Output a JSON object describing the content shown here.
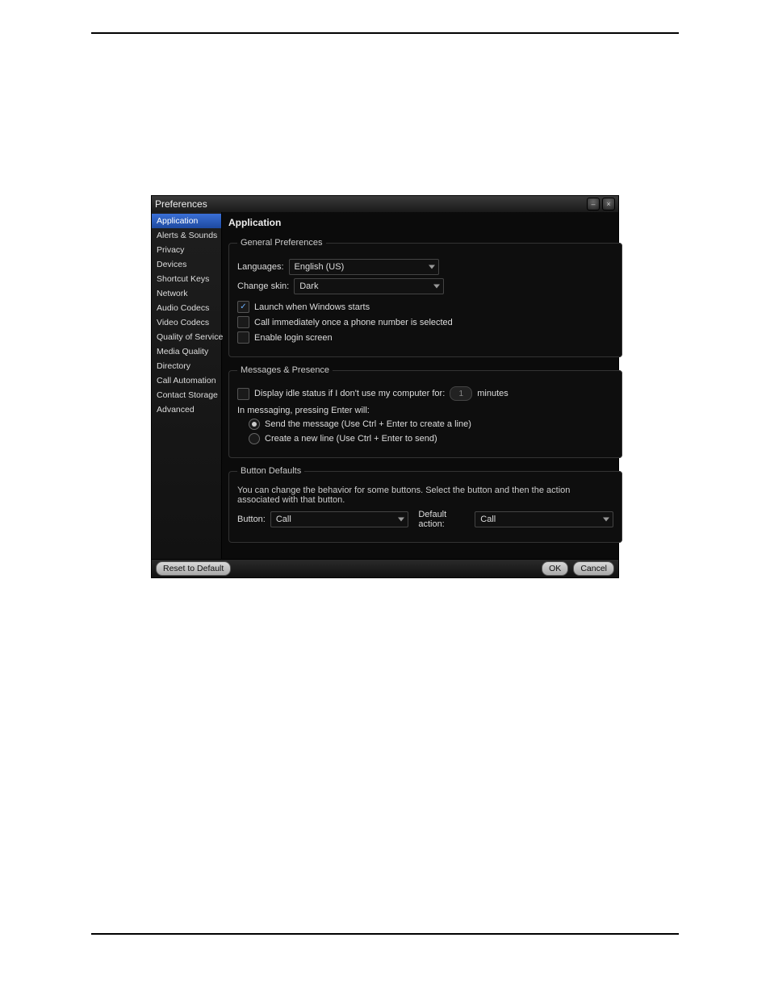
{
  "window": {
    "title": "Preferences"
  },
  "sidebar": {
    "items": [
      {
        "label": "Application"
      },
      {
        "label": "Alerts & Sounds"
      },
      {
        "label": "Privacy"
      },
      {
        "label": "Devices"
      },
      {
        "label": "Shortcut Keys"
      },
      {
        "label": "Network"
      },
      {
        "label": "Audio Codecs"
      },
      {
        "label": "Video Codecs"
      },
      {
        "label": "Quality of Service"
      },
      {
        "label": "Media Quality"
      },
      {
        "label": "Directory"
      },
      {
        "label": "Call Automation"
      },
      {
        "label": "Contact Storage"
      },
      {
        "label": "Advanced"
      }
    ],
    "selected_index": 0
  },
  "panel": {
    "heading": "Application",
    "general": {
      "legend": "General Preferences",
      "languages_label": "Languages:",
      "languages_value": "English (US)",
      "skin_label": "Change skin:",
      "skin_value": "Dark",
      "launch_label": "Launch when Windows starts",
      "call_label": "Call immediately once a phone number is selected",
      "login_label": "Enable login screen",
      "launch_checked": true,
      "call_checked": false,
      "login_checked": false
    },
    "messages": {
      "legend": "Messages & Presence",
      "idle_label_pre": "Display idle status if I don't use my computer for:",
      "idle_value": "1",
      "idle_label_post": "minutes",
      "idle_checked": false,
      "enter_heading": "In messaging, pressing Enter will:",
      "radio_send": "Send the message (Use Ctrl + Enter to create a line)",
      "radio_newline": "Create a new line (Use Ctrl + Enter to send)",
      "radio_selected": 0
    },
    "button_defaults": {
      "legend": "Button Defaults",
      "description": "You can change the behavior for some buttons. Select the button and then the action associated with that button.",
      "button_label": "Button:",
      "button_value": "Call",
      "action_label": "Default action:",
      "action_value": "Call"
    }
  },
  "footer": {
    "reset": "Reset to Default",
    "ok": "OK",
    "cancel": "Cancel"
  }
}
